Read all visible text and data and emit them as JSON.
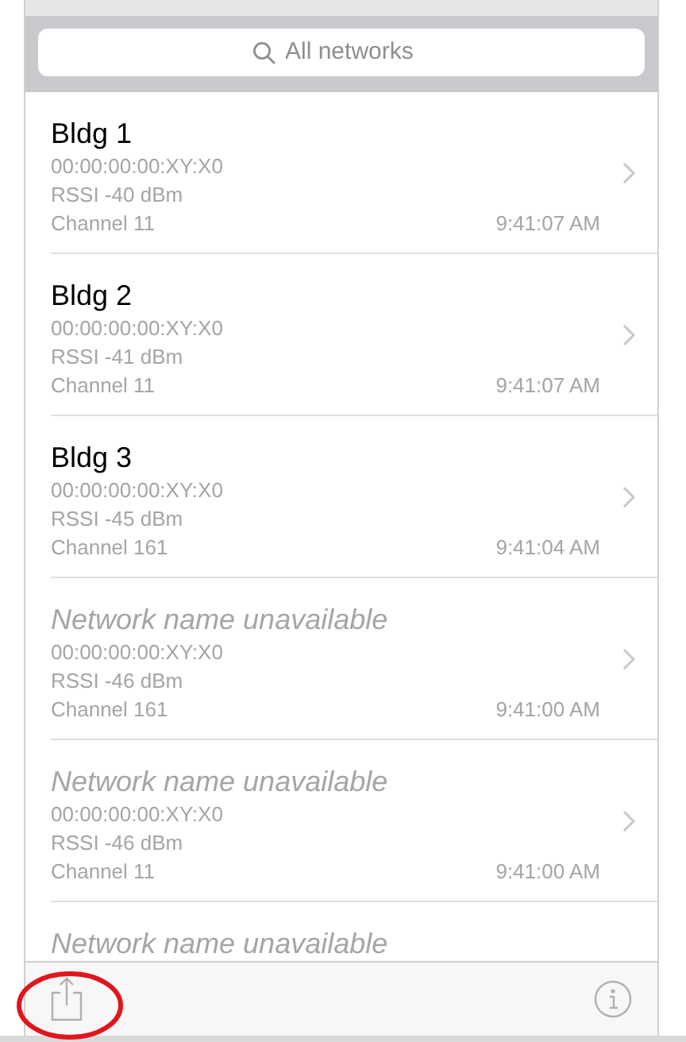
{
  "search": {
    "placeholder": "All networks"
  },
  "networks": [
    {
      "kind": "named",
      "name": "Bldg 1",
      "address": "00:00:00:00:XY:X0",
      "rssi": "RSSI -40 dBm",
      "channel": "Channel 11",
      "time": "9:41:07 AM"
    },
    {
      "kind": "named",
      "name": "Bldg 2",
      "address": "00:00:00:00:XY:X0",
      "rssi": "RSSI -41 dBm",
      "channel": "Channel 11",
      "time": "9:41:07 AM"
    },
    {
      "kind": "named",
      "name": "Bldg 3",
      "address": "00:00:00:00:XY:X0",
      "rssi": "RSSI -45 dBm",
      "channel": "Channel 161",
      "time": "9:41:04 AM"
    },
    {
      "kind": "unavailable",
      "name": "Network name unavailable",
      "address": "00:00:00:00:XY:X0",
      "rssi": "RSSI -46 dBm",
      "channel": "Channel 161",
      "time": "9:41:00 AM"
    },
    {
      "kind": "unavailable",
      "name": "Network name unavailable",
      "address": "00:00:00:00:XY:X0",
      "rssi": "RSSI -46 dBm",
      "channel": "Channel 11",
      "time": "9:41:00 AM"
    },
    {
      "kind": "unavailable",
      "name": "Network name unavailable"
    }
  ]
}
